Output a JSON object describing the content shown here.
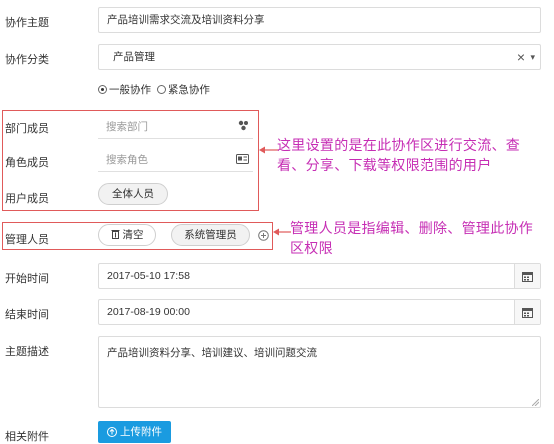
{
  "form": {
    "subject": {
      "label": "协作主题",
      "value": "产品培训需求交流及培训资料分享"
    },
    "category": {
      "label": "协作分类",
      "value": "产品管理",
      "clear": "×",
      "caret": "▾"
    },
    "priority": {
      "options": [
        "一般协作",
        "紧急协作"
      ],
      "selected": 0
    },
    "dept_members": {
      "label": "部门成员",
      "placeholder": "搜索部门"
    },
    "role_members": {
      "label": "角色成员",
      "placeholder": "搜索角色"
    },
    "user_members": {
      "label": "用户成员",
      "tag": "全体人员"
    },
    "managers": {
      "label": "管理人员",
      "clear_label": "清空",
      "tag": "系统管理员"
    },
    "start_time": {
      "label": "开始时间",
      "value": "2017-05-10 17:58"
    },
    "end_time": {
      "label": "结束时间",
      "value": "2017-08-19 00:00"
    },
    "description": {
      "label": "主题描述",
      "value": "产品培训资料分享、培训建议、培训问题交流"
    },
    "attachments": {
      "label": "相关附件",
      "button": "上传附件"
    }
  },
  "annotations": {
    "members_note": [
      "这里设置的是在此协作区进行交流、查",
      "看、分享、下载等权限范围的用户"
    ],
    "managers_note": [
      "管理人员是指编辑、删除、管理此协作",
      "区权限"
    ]
  },
  "colors": {
    "annotation": "#c62eb4",
    "highlight_border": "#e05a5a",
    "primary": "#1a9be0"
  }
}
